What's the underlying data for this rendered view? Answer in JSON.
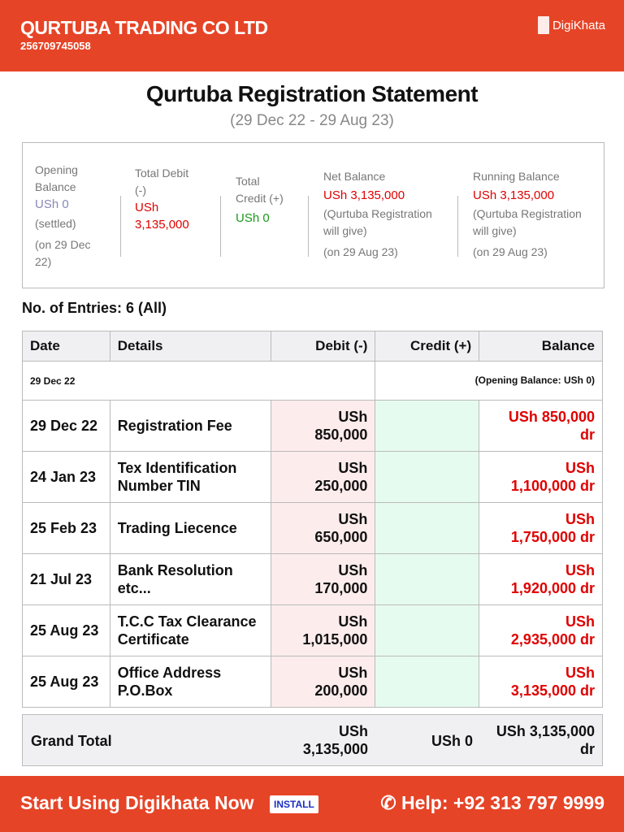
{
  "header": {
    "company": "QURTUBA TRADING CO LTD",
    "phone": "256709745058",
    "brand": "DigiKhata"
  },
  "title": "Qurtuba Registration Statement",
  "range": "(29 Dec 22 - 29 Aug 23)",
  "summary": {
    "opening": {
      "label": "Opening Balance",
      "value": "USh 0",
      "note": "(settled)",
      "date": "(on 29 Dec 22)"
    },
    "debit": {
      "label": "Total Debit (-)",
      "value": "USh 3,135,000"
    },
    "credit": {
      "label": "Total Credit (+)",
      "value": "USh 0"
    },
    "net": {
      "label": "Net Balance",
      "value": "USh 3,135,000",
      "note": "(Qurtuba Registration will give)",
      "date": "(on 29 Aug 23)"
    },
    "running": {
      "label": "Running Balance",
      "value": "USh 3,135,000",
      "note": "(Qurtuba Registration will give)",
      "date": "(on 29 Aug 23)"
    }
  },
  "entries_label": "No. of Entries: 6 (All)",
  "table": {
    "headers": [
      "Date",
      "Details",
      "Debit (-)",
      "Credit (+)",
      "Balance"
    ],
    "opening_row": {
      "date": "29 Dec 22",
      "balance": "(Opening Balance: USh 0)"
    },
    "rows": [
      {
        "date": "29 Dec 22",
        "details": "Registration Fee",
        "debit": "USh 850,000",
        "credit": "",
        "balance": "USh 850,000 dr"
      },
      {
        "date": "24 Jan 23",
        "details": "Tex Identification Number TIN",
        "debit": "USh 250,000",
        "credit": "",
        "balance": "USh 1,100,000 dr"
      },
      {
        "date": "25 Feb 23",
        "details": "Trading Liecence",
        "debit": "USh 650,000",
        "credit": "",
        "balance": "USh 1,750,000 dr"
      },
      {
        "date": "21 Jul 23",
        "details": "Bank Resolution etc...",
        "debit": "USh 170,000",
        "credit": "",
        "balance": "USh 1,920,000 dr"
      },
      {
        "date": "25 Aug 23",
        "details": "T.C.C Tax Clearance Certificate",
        "debit": "USh 1,015,000",
        "credit": "",
        "balance": "USh 2,935,000 dr"
      },
      {
        "date": "25 Aug 23",
        "details": "Office Address P.O.Box",
        "debit": "USh 200,000",
        "credit": "",
        "balance": "USh 3,135,000 dr"
      }
    ],
    "total": {
      "label": "Grand Total",
      "debit": "USh 3,135,000",
      "credit": "USh 0",
      "balance": "USh 3,135,000 dr"
    }
  },
  "footer": {
    "cta": "Start Using Digikhata Now",
    "install": "INSTALL",
    "help": "Help: +92 313 797 9999"
  }
}
